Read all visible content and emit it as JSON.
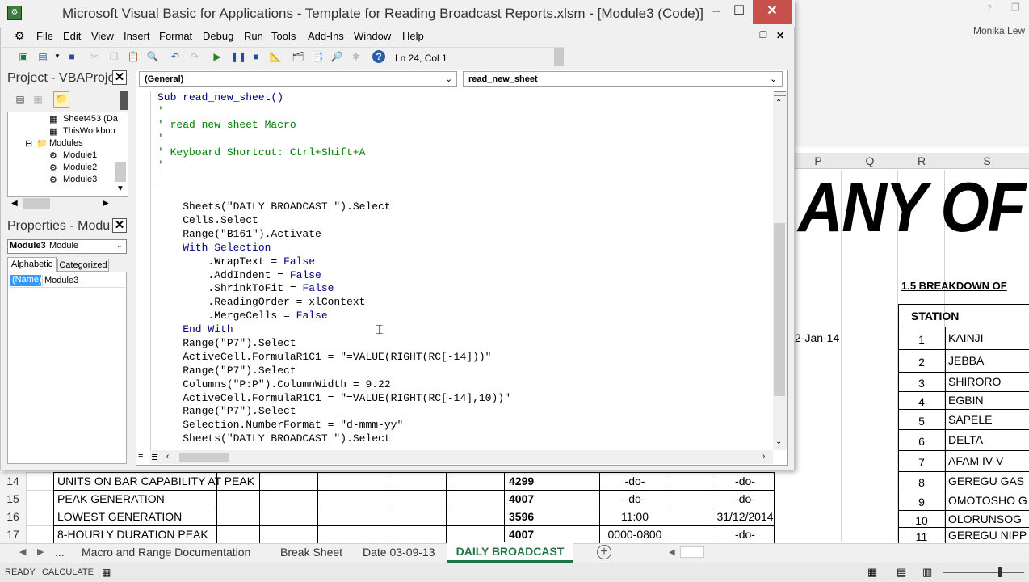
{
  "vbe": {
    "title": "Microsoft Visual Basic for Applications - Template for Reading Broadcast Reports.xlsm - [Module3 (Code)]",
    "menus": [
      "File",
      "Edit",
      "View",
      "Insert",
      "Format",
      "Debug",
      "Run",
      "Tools",
      "Add-Ins",
      "Window",
      "Help"
    ],
    "cursor_pos": "Ln 24, Col 1",
    "project_title": "Project - VBAProje",
    "tree": [
      "Sheet453 (Da",
      "ThisWorkboo",
      "Modules",
      "Module1",
      "Module2",
      "Module3"
    ],
    "props_title": "Properties - Modu",
    "props_object": "Module3",
    "props_object_type": "Module",
    "props_tabs": [
      "Alphabetic",
      "Categorized"
    ],
    "props_name_key": "(Name)",
    "props_name_val": "Module3",
    "combo_left": "(General)",
    "combo_right": "read_new_sheet",
    "code": [
      {
        "t": "Sub read_new_sheet()",
        "c": "kw"
      },
      {
        "t": "'",
        "c": "cm"
      },
      {
        "t": "' read_new_sheet Macro",
        "c": "cm"
      },
      {
        "t": "'",
        "c": "cm"
      },
      {
        "t": "' Keyboard Shortcut: Ctrl+Shift+A",
        "c": "cm"
      },
      {
        "t": "'",
        "c": "cm"
      },
      {
        "t": "",
        "c": ""
      },
      {
        "t": "",
        "c": ""
      },
      {
        "t": "    Sheets(\"DAILY BROADCAST \").Select",
        "c": ""
      },
      {
        "t": "    Cells.Select",
        "c": ""
      },
      {
        "t": "    Range(\"B161\").Activate",
        "c": ""
      },
      {
        "t": "    With Selection",
        "c": "kw"
      },
      {
        "t": "        .WrapText = False",
        "c": "mix"
      },
      {
        "t": "        .AddIndent = False",
        "c": "mix"
      },
      {
        "t": "        .ShrinkToFit = False",
        "c": "mix"
      },
      {
        "t": "        .ReadingOrder = xlContext",
        "c": ""
      },
      {
        "t": "        .MergeCells = False",
        "c": "mix"
      },
      {
        "t": "    End With",
        "c": "kw"
      },
      {
        "t": "    Range(\"P7\").Select",
        "c": ""
      },
      {
        "t": "    ActiveCell.FormulaR1C1 = \"=VALUE(RIGHT(RC[-14]))\"",
        "c": ""
      },
      {
        "t": "    Range(\"P7\").Select",
        "c": ""
      },
      {
        "t": "    Columns(\"P:P\").ColumnWidth = 9.22",
        "c": ""
      },
      {
        "t": "    ActiveCell.FormulaR1C1 = \"=VALUE(RIGHT(RC[-14],10))\"",
        "c": ""
      },
      {
        "t": "    Range(\"P7\").Select",
        "c": ""
      },
      {
        "t": "    Selection.NumberFormat = \"d-mmm-yy\"",
        "c": ""
      },
      {
        "t": "    Sheets(\"DAILY BROADCAST \").Select",
        "c": ""
      }
    ]
  },
  "excel": {
    "user": "Monika Lew",
    "columns": [
      "P",
      "Q",
      "R",
      "S"
    ],
    "banner": "ANY OF",
    "breakdown_title": "1.5 BREAKDOWN OF",
    "date_cell": "2-Jan-14",
    "station_header": "STATION",
    "stations": [
      {
        "n": "1",
        "name": "KAINJI"
      },
      {
        "n": "2",
        "name": "JEBBA"
      },
      {
        "n": "3",
        "name": "SHIRORO"
      },
      {
        "n": "4",
        "name": "EGBIN"
      },
      {
        "n": "5",
        "name": "SAPELE"
      },
      {
        "n": "6",
        "name": "DELTA"
      },
      {
        "n": "7",
        "name": "AFAM IV-V"
      },
      {
        "n": "8",
        "name": "GEREGU GAS"
      },
      {
        "n": "9",
        "name": "OMOTOSHO G"
      },
      {
        "n": "10",
        "name": "OLORUNSOG"
      },
      {
        "n": "11",
        "name": "GEREGU NIPP"
      }
    ],
    "rows": [
      {
        "num": "14",
        "label": "UNITS ON BAR CAPABILITY AT PEAK",
        "val": "4299",
        "time": "-do-",
        "date": "-do-"
      },
      {
        "num": "15",
        "label": "PEAK GENERATION",
        "val": "4007",
        "time": "-do-",
        "date": "-do-"
      },
      {
        "num": "16",
        "label": "LOWEST GENERATION",
        "val": "3596",
        "time": "11:00",
        "date": "31/12/2014"
      },
      {
        "num": "17",
        "label": "8-HOURLY DURATION PEAK",
        "val": "4007",
        "time": "0000-0800",
        "date": "-do-"
      }
    ],
    "tabs": [
      "Macro and Range Documentation",
      "Break Sheet",
      "Date 03-09-13"
    ],
    "active_tab": "DAILY BROADCAST",
    "more": "...",
    "status_ready": "READY",
    "status_calc": "CALCULATE"
  }
}
